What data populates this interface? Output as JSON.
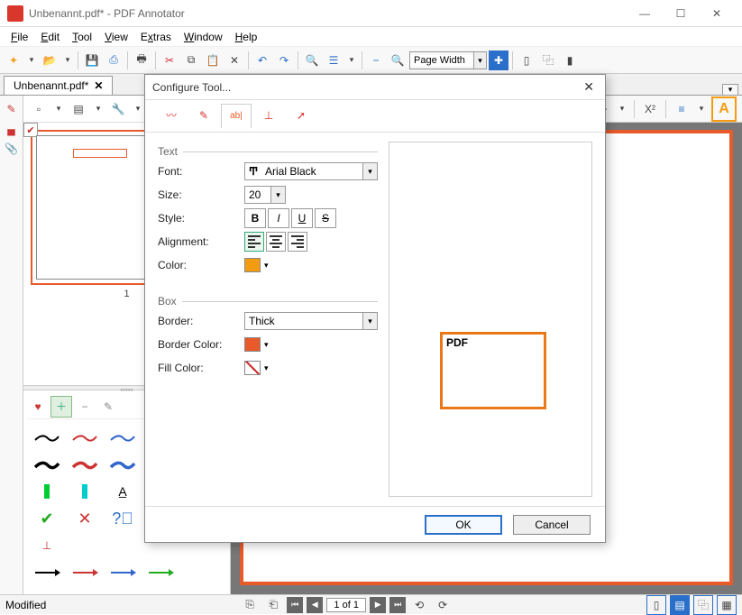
{
  "window": {
    "title": "Unbenannt.pdf* - PDF Annotator"
  },
  "menu": {
    "file": "File",
    "edit": "Edit",
    "tool": "Tool",
    "view": "View",
    "extras": "Extras",
    "window": "Window",
    "help": "Help"
  },
  "toolbar": {
    "zoom": "Page Width"
  },
  "tabs": {
    "doc": "Unbenannt.pdf*"
  },
  "thumb": {
    "page_num": "1"
  },
  "dialog": {
    "title": "Configure Tool...",
    "section_text": "Text",
    "section_box": "Box",
    "font_label": "Font:",
    "font_value": "Arial Black",
    "size_label": "Size:",
    "size_value": "20",
    "style_label": "Style:",
    "alignment_label": "Alignment:",
    "color_label": "Color:",
    "border_label": "Border:",
    "border_value": "Thick",
    "border_color_label": "Border Color:",
    "fill_color_label": "Fill Color:",
    "preview_text": "PDF",
    "ok": "OK",
    "cancel": "Cancel",
    "colors": {
      "text": "#f39c12",
      "border": "#e85a2a",
      "fill": "transparent"
    }
  },
  "status": {
    "modified": "Modified",
    "page": "1 of 1"
  },
  "chart_data": null
}
